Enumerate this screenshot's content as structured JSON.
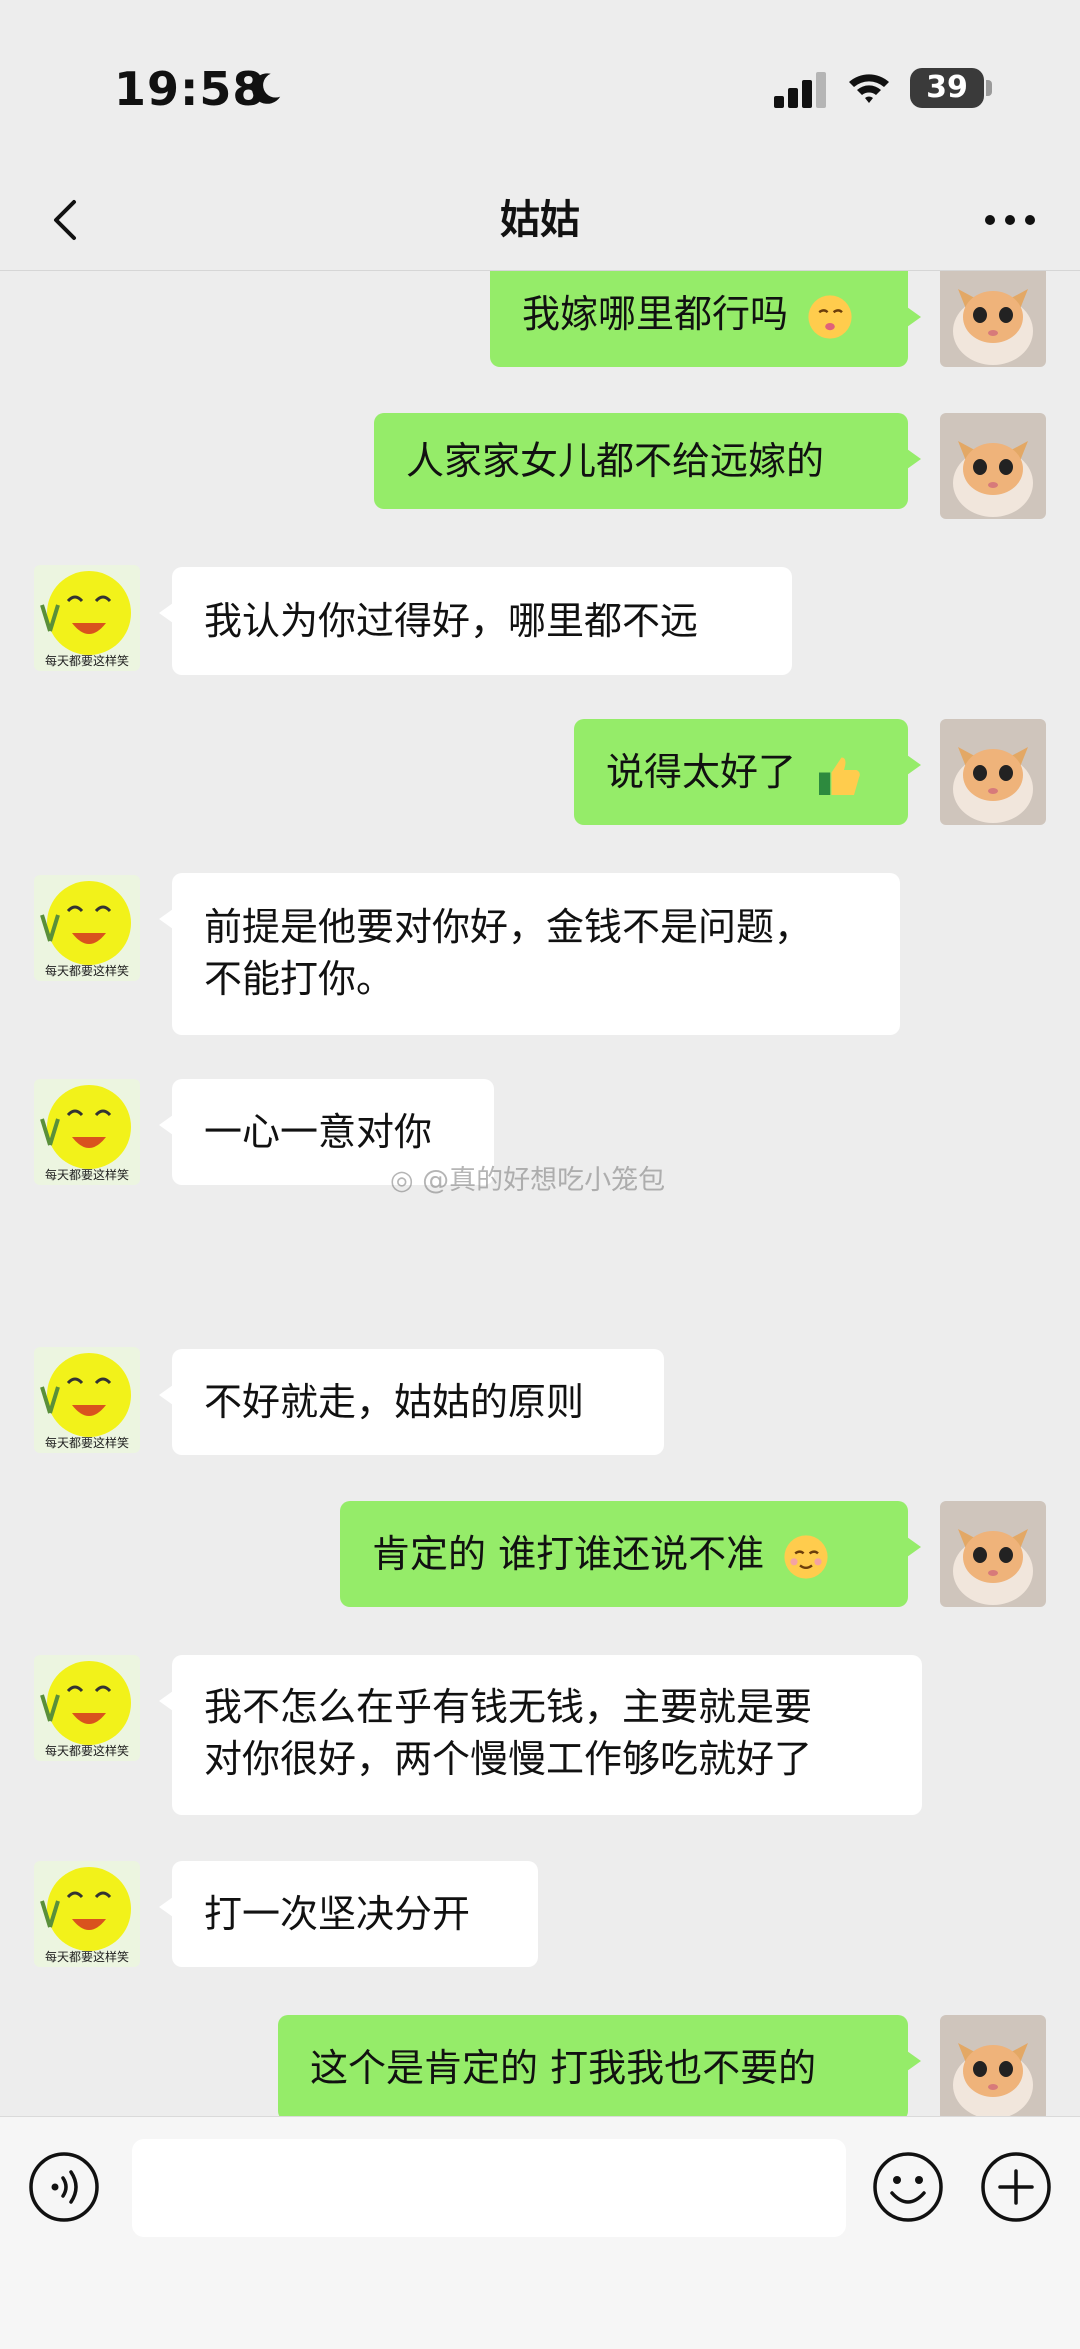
{
  "status_bar": {
    "time": "19:58",
    "battery": "39"
  },
  "header": {
    "title": "姑姑"
  },
  "messages": [
    {
      "side": "out",
      "text": "我嫁哪里都行吗"
    },
    {
      "side": "out",
      "text": "人家家女儿都不给远嫁的"
    },
    {
      "side": "in",
      "text": "我认为你过得好，哪里都不远"
    },
    {
      "side": "out",
      "text": "说得太好了"
    },
    {
      "side": "in",
      "line1": "前提是他要对你好，金钱不是问题，",
      "line2": "不能打你。"
    },
    {
      "side": "in",
      "text": "一心一意对你"
    },
    {
      "side": "in",
      "text": "不好就走，姑姑的原则"
    },
    {
      "side": "out",
      "text": "肯定的  谁打谁还说不准"
    },
    {
      "side": "in",
      "line1": "我不怎么在乎有钱无钱，主要就是要",
      "line2": "对你很好，两个慢慢工作够吃就好了"
    },
    {
      "side": "in",
      "text": "打一次坚决分开"
    },
    {
      "side": "out",
      "text": "这个是肯定的 打我我也不要的"
    }
  ],
  "avatar_caption": "每天都要这样笑",
  "watermark": "@真的好想吃小笼包",
  "input": {
    "value": ""
  },
  "icons": {
    "moon": "moon-icon",
    "signal": "signal-icon",
    "wifi": "wifi-icon",
    "back": "chevron-left-icon",
    "more": "more-icon",
    "voice": "voice-icon",
    "emoji": "emoji-icon",
    "plus": "plus-icon"
  },
  "colors": {
    "outgoing_bubble": "#95ec69",
    "incoming_bubble": "#ffffff",
    "background": "#ededed"
  }
}
